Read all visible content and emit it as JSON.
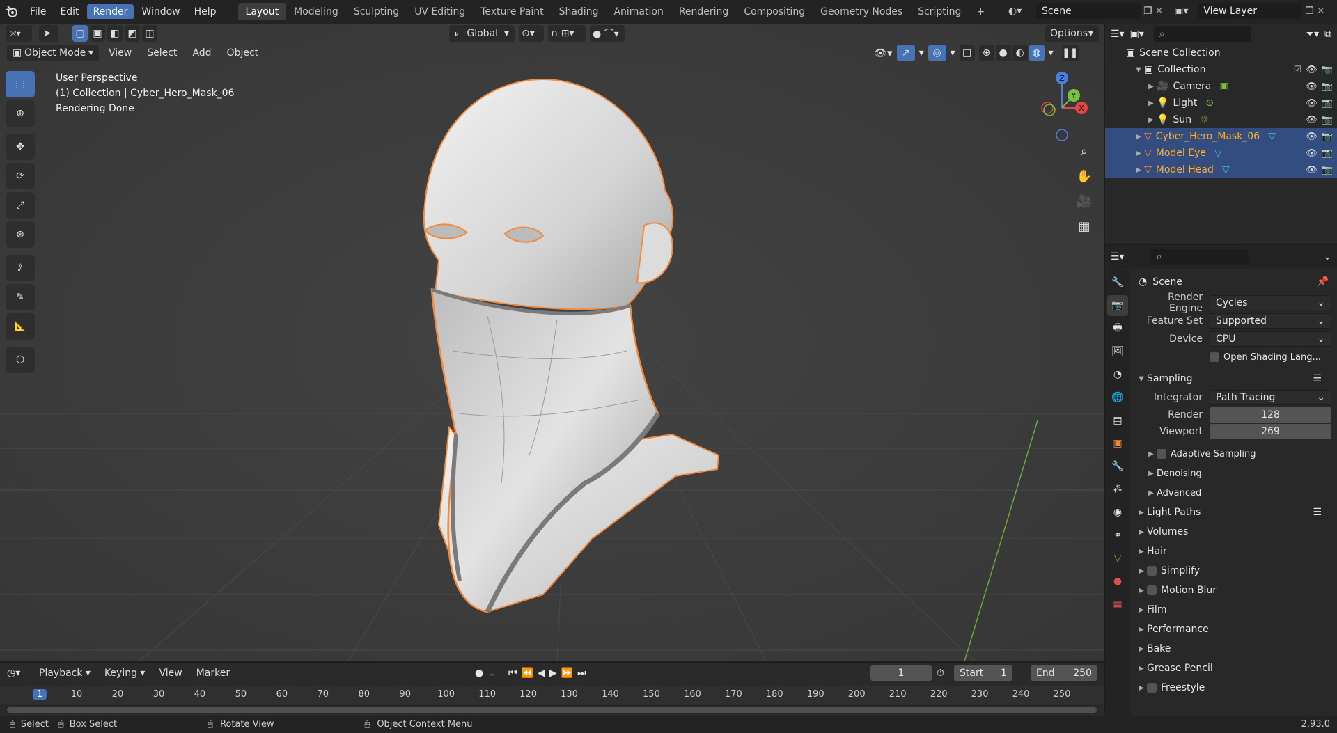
{
  "topbar": {
    "menus": [
      "File",
      "Edit",
      "Render",
      "Window",
      "Help"
    ],
    "active_menu": "Render",
    "workspaces": [
      "Layout",
      "Modeling",
      "Sculpting",
      "UV Editing",
      "Texture Paint",
      "Shading",
      "Animation",
      "Rendering",
      "Compositing",
      "Geometry Nodes",
      "Scripting"
    ],
    "active_workspace": "Layout",
    "add_workspace": "+",
    "scene": "Scene",
    "view_layer": "View Layer"
  },
  "viewport": {
    "orientation": "Global",
    "options": "Options",
    "mode": "Object Mode",
    "menus": [
      "View",
      "Select",
      "Add",
      "Object"
    ],
    "info": {
      "line1": "User Perspective",
      "line2": "(1) Collection | Cyber_Hero_Mask_06",
      "line3": "Rendering Done"
    },
    "gizmo": {
      "z": "Z",
      "y": "Y",
      "x": "X"
    }
  },
  "outliner": {
    "root": "Scene Collection",
    "collection": "Collection",
    "items": [
      {
        "label": "Camera",
        "selected": false,
        "indent": 2
      },
      {
        "label": "Light",
        "selected": false,
        "indent": 2
      },
      {
        "label": "Sun",
        "selected": false,
        "indent": 2
      },
      {
        "label": "Cyber_Hero_Mask_06",
        "selected": true,
        "indent": 1
      },
      {
        "label": "Model Eye",
        "selected": true,
        "indent": 1
      },
      {
        "label": "Model Head",
        "selected": true,
        "indent": 1
      }
    ]
  },
  "properties": {
    "context": "Scene",
    "render_engine_label": "Render Engine",
    "render_engine": "Cycles",
    "feature_set_label": "Feature Set",
    "feature_set": "Supported",
    "device_label": "Device",
    "device": "CPU",
    "osl_label": "Open Shading Lang...",
    "sampling": "Sampling",
    "integrator_label": "Integrator",
    "integrator": "Path Tracing",
    "render_label": "Render",
    "render_samples": "128",
    "viewport_label": "Viewport",
    "viewport_samples": "269",
    "sub_panels": [
      "Adaptive Sampling",
      "Denoising",
      "Advanced"
    ],
    "panels": [
      "Light Paths",
      "Volumes",
      "Hair",
      "Simplify",
      "Motion Blur",
      "Film",
      "Performance",
      "Bake",
      "Grease Pencil",
      "Freestyle"
    ]
  },
  "timeline": {
    "menus": [
      "Playback",
      "Keying",
      "View",
      "Marker"
    ],
    "current_frame": "1",
    "start_label": "Start",
    "start": "1",
    "end_label": "End",
    "end": "250",
    "ruler": [
      "1",
      "10",
      "20",
      "30",
      "40",
      "50",
      "60",
      "70",
      "80",
      "90",
      "100",
      "110",
      "120",
      "130",
      "140",
      "150",
      "160",
      "170",
      "180",
      "190",
      "200",
      "210",
      "220",
      "230",
      "240",
      "250"
    ]
  },
  "status": {
    "select": "Select",
    "box_select": "Box Select",
    "rotate": "Rotate View",
    "context_menu": "Object Context Menu",
    "version": "2.93.0"
  },
  "colors": {
    "accent": "#4772b3",
    "selection_outline": "#f28a3b",
    "grid_y_axis": "#6fa83a"
  }
}
